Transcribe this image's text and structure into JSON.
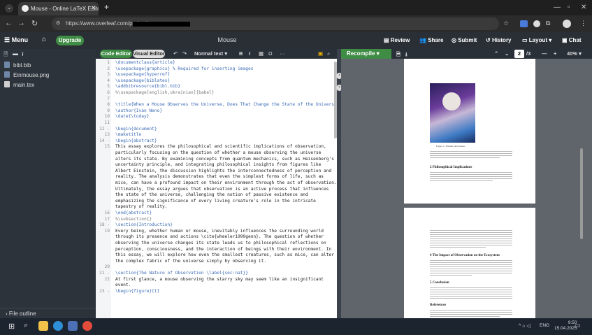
{
  "browser": {
    "tab_title": "Mouse - Online LaTeX Editor Over",
    "url": "https://www.overleaf.com/project/",
    "window_controls": [
      "minimize-icon",
      "maximize-icon",
      "close-icon"
    ]
  },
  "overleaf": {
    "menu_label": "Menu",
    "upgrade_label": "Upgrade",
    "project_title": "Mouse",
    "review_label": "Review",
    "share_label": "Share",
    "submit_label": "Submit",
    "history_label": "History",
    "layout_label": "Layout",
    "chat_label": "Chat"
  },
  "sidebar": {
    "files": [
      {
        "name": "bibl.bib",
        "icon": "bib-file-icon",
        "color": "#6f88a8"
      },
      {
        "name": "Einmouse.png",
        "icon": "image-file-icon",
        "color": "#6f88a8"
      },
      {
        "name": "main.tex",
        "icon": "tex-file-icon",
        "color": "#cfcfcf"
      }
    ],
    "file_outline_label": "File outline"
  },
  "editor_toolbar": {
    "code_editor_label": "Code Editor",
    "visual_editor_label": "Visual Editor",
    "text_style": "Normal text",
    "bold": "B",
    "italic": "I",
    "omega": "Ω",
    "more": "···"
  },
  "editor": {
    "lines": [
      {
        "n": "1",
        "t": "\\documentclass{article}",
        "k": "cmd"
      },
      {
        "n": "2",
        "t": "\\usepackage{graphicx} % Required for inserting images",
        "k": "cmd"
      },
      {
        "n": "3",
        "t": "\\usepackage{hyperref}",
        "k": "cmd"
      },
      {
        "n": "4",
        "t": "\\usepackage{biblatex}",
        "k": "cmd"
      },
      {
        "n": "5",
        "t": "\\addbibresource{bibl.bib}",
        "k": "cmd"
      },
      {
        "n": "6",
        "t": "%\\usepackage[english,ukrainian]{babel}",
        "k": "comment"
      },
      {
        "n": "7",
        "t": "",
        "k": "text"
      },
      {
        "n": "8",
        "t": "\\title{When a Mouse Observes the Universe, Does That Change the State of the Universe?}",
        "k": "cmd"
      },
      {
        "n": "9",
        "t": "\\author{Ivan Neno}",
        "k": "cmd"
      },
      {
        "n": "10",
        "t": "\\date{\\today}",
        "k": "cmd"
      },
      {
        "n": "11",
        "t": "",
        "k": "text"
      },
      {
        "n": "12 -",
        "t": "\\begin{document}",
        "k": "cmd"
      },
      {
        "n": "13",
        "t": "\\maketitle",
        "k": "cmd"
      },
      {
        "n": "14 -",
        "t": "\\begin{abstract}",
        "k": "cmd"
      },
      {
        "n": "15",
        "t": "This essay explores the philosophical and scientific implications of observation,",
        "k": "text"
      },
      {
        "n": "",
        "t": "particularly focusing on the question of whether a mouse observing the universe",
        "k": "text"
      },
      {
        "n": "",
        "t": "alters its state. By examining concepts from quantum mechanics, such as Heisenberg's",
        "k": "text"
      },
      {
        "n": "",
        "t": "uncertainty principle, and integrating philosophical insights from figures like",
        "k": "text"
      },
      {
        "n": "",
        "t": "Albert Einstein, the discussion highlights the interconnectedness of perception and",
        "k": "text"
      },
      {
        "n": "",
        "t": "reality. The analysis demonstrates that even the simplest forms of life, such as",
        "k": "text"
      },
      {
        "n": "",
        "t": "mice, can have a profound impact on their environment through the act of observation.",
        "k": "text"
      },
      {
        "n": "",
        "t": "Ultimately, the essay argues that observation is an active process that influences",
        "k": "text"
      },
      {
        "n": "",
        "t": "the state of the universe, challenging the notion of passive existence and",
        "k": "text"
      },
      {
        "n": "",
        "t": "emphasizing the significance of every living creature's role in the intricate",
        "k": "text"
      },
      {
        "n": "",
        "t": "tapestry of reality.",
        "k": "text"
      },
      {
        "n": "16",
        "t": "\\end{abstract}",
        "k": "cmd"
      },
      {
        "n": "17",
        "t": "%\\subsection{}",
        "k": "comment"
      },
      {
        "n": "18 -",
        "t": "\\section{Introduction}",
        "k": "cmd"
      },
      {
        "n": "19",
        "t": "Every being, whether human or mouse, inevitably influences the surrounding world",
        "k": "text"
      },
      {
        "n": "",
        "t": "through its presence and actions \\cite{wheeler1999genn}. The question of whether",
        "k": "text"
      },
      {
        "n": "",
        "t": "observing the universe changes its state leads us to philosophical reflections on",
        "k": "text"
      },
      {
        "n": "",
        "t": "perception, consciousness, and the interaction of beings with their environment. In",
        "k": "text"
      },
      {
        "n": "",
        "t": "this essay, we will explore how even the smallest creatures, such as mice, can alter",
        "k": "text"
      },
      {
        "n": "",
        "t": "the complex fabric of the universe simply by observing it.",
        "k": "text"
      },
      {
        "n": "20",
        "t": "",
        "k": "text"
      },
      {
        "n": "21 -",
        "t": "\\section{The Nature of Observation  \\label{sec:nat}}",
        "k": "cmd"
      },
      {
        "n": "22",
        "t": "At first glance, a mouse observing the starry sky may seem like an insignificant",
        "k": "text"
      },
      {
        "n": "",
        "t": "event.",
        "k": "text"
      },
      {
        "n": "23 -",
        "t": "\\begin{figure}[t]",
        "k": "cmd"
      }
    ]
  },
  "pdf_toolbar": {
    "recompile_label": "Recompile",
    "current_page": "2",
    "total_pages": "/3",
    "zoom": "40%"
  },
  "pdf": {
    "figure_caption": "Figure 1: Einstein and mouse.",
    "page1_heading": "2 Philosophical Implications",
    "page2_heading1": "4 The Impact of Observation on the Ecosystem",
    "page2_heading2": "5 Conclusion",
    "page2_heading3": "References"
  },
  "taskbar": {
    "language": "ENG",
    "time": "9:50",
    "date": "15.04.2025"
  },
  "colors": {
    "accent_green": "#3f8c45",
    "toolbar_dark": "#2a3038",
    "sidebar": "#2c333b"
  }
}
